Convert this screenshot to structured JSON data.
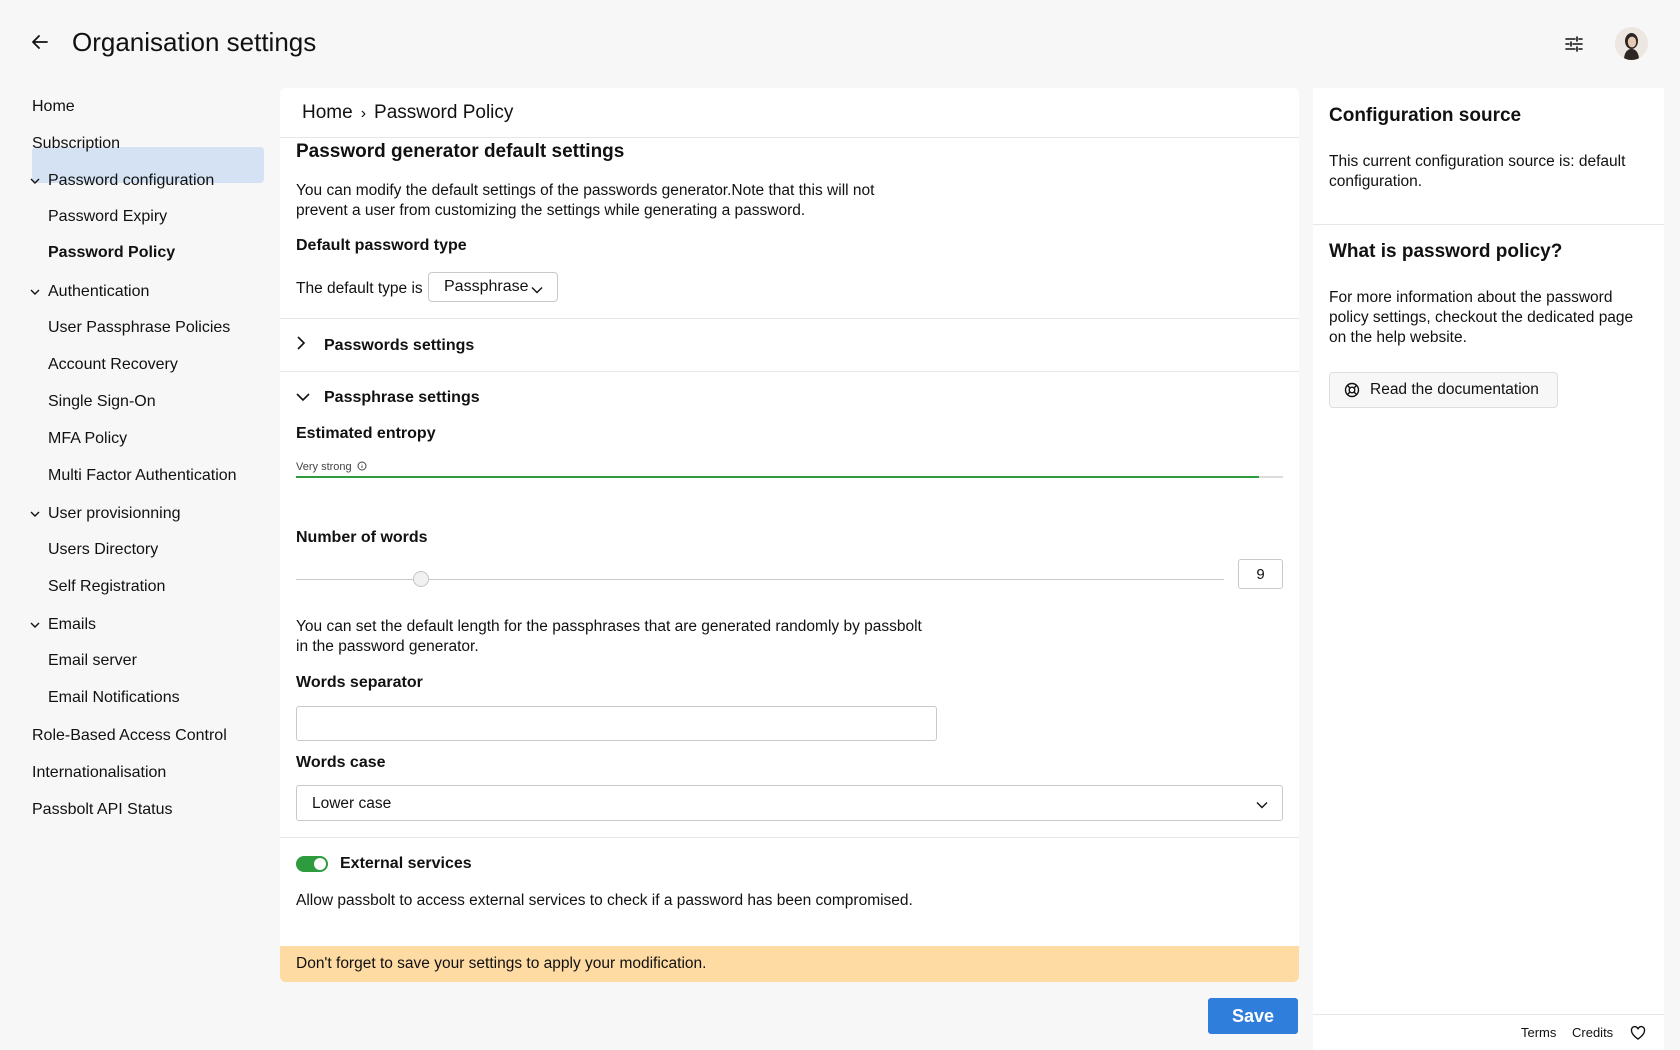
{
  "header": {
    "title": "Organisation settings",
    "back_icon": "arrow-left-icon",
    "filter_icon": "sliders-icon"
  },
  "sidebar": {
    "items": [
      {
        "label": "Home"
      },
      {
        "label": "Subscription"
      },
      {
        "label": "Password configuration",
        "expanded": true
      },
      {
        "label": "Password Expiry"
      },
      {
        "label": "Password Policy",
        "selected": true
      },
      {
        "label": "Authentication",
        "expanded": true
      },
      {
        "label": "User Passphrase Policies"
      },
      {
        "label": "Account Recovery"
      },
      {
        "label": "Single Sign-On"
      },
      {
        "label": "MFA Policy"
      },
      {
        "label": "Multi Factor Authentication"
      },
      {
        "label": "User provisionning",
        "expanded": true
      },
      {
        "label": "Users Directory"
      },
      {
        "label": "Self Registration"
      },
      {
        "label": "Emails",
        "expanded": true
      },
      {
        "label": "Email server"
      },
      {
        "label": "Email Notifications"
      },
      {
        "label": "Role-Based Access Control"
      },
      {
        "label": "Internationalisation"
      },
      {
        "label": "Passbolt API Status"
      }
    ]
  },
  "breadcrumb": {
    "home": "Home",
    "separator": "›",
    "current": "Password Policy"
  },
  "main": {
    "title": "Password generator default settings",
    "intro_line1": "You can modify the default settings of the passwords generator.Note that this will not",
    "intro_line2": "prevent a user from customizing the settings while generating a password.",
    "default_type_label": "Default password type",
    "default_type_prefix": "The default type is",
    "default_type_value": "Passphrase",
    "passwords_settings_label": "Passwords settings",
    "passphrase_settings_label": "Passphrase settings",
    "entropy_label": "Estimated entropy",
    "entropy_strength": "Very strong",
    "entropy_fraction": 0.976,
    "words_label": "Number of words",
    "words_value": "9",
    "words_slider_fraction": 0.135,
    "words_help_line1": "You can set the default length for the passphrases that are generated randomly by passbolt",
    "words_help_line2": "in the password generator.",
    "separator_label": "Words separator",
    "separator_value": "",
    "case_label": "Words case",
    "case_value": "Lower case",
    "external_label": "External services",
    "external_enabled": true,
    "external_help": "Allow passbolt to access external services to check if a password has been compromised.",
    "warning": "Don't forget to save your settings to apply your modification.",
    "save_label": "Save"
  },
  "aside": {
    "config_title": "Configuration source",
    "config_text": "This current configuration source is: default configuration.",
    "policy_title": "What is password policy?",
    "policy_text": "For more information about the password policy settings, checkout the dedicated page on the help website.",
    "doc_button": "Read the documentation"
  },
  "footer": {
    "terms": "Terms",
    "credits": "Credits"
  },
  "colors": {
    "accent": "#2f7edb",
    "success": "#2e9c3e",
    "warning_bg": "#fedba3",
    "selected_bg": "#d4e2f3"
  }
}
